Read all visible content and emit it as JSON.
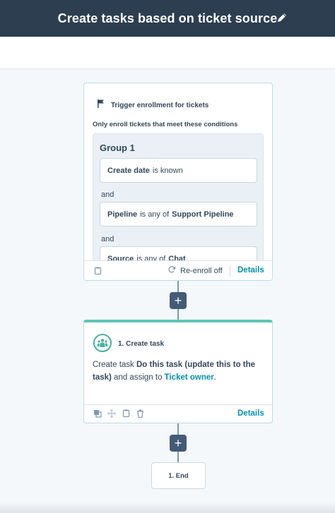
{
  "header": {
    "title": "Create tasks based on ticket source",
    "edit_icon": "pencil-icon"
  },
  "trigger": {
    "icon": "flag-icon",
    "title": "Trigger enrollment for tickets",
    "caption": "Only enroll tickets that meet these conditions",
    "group_title": "Group 1",
    "conditions": [
      {
        "field": "Create date",
        "operator": "is known",
        "value": ""
      },
      {
        "field": "Pipeline",
        "operator": "is any of",
        "value": "Support Pipeline"
      },
      {
        "field": "Source",
        "operator": "is any of",
        "value": "Chat"
      }
    ],
    "and_label": "and",
    "footer": {
      "copy_icon": "copy-icon",
      "reenroll_icon": "refresh-icon",
      "reenroll_label": "Re-enroll off",
      "details_label": "Details"
    }
  },
  "add_action_label": "+",
  "task": {
    "icon": "team-icon",
    "title": "1. Create task",
    "body_prefix": "Create task ",
    "task_name": "Do this task (update this to the task)",
    "body_mid": " and assign to ",
    "assignee": "Ticket owner",
    "body_suffix": ".",
    "footer": {
      "icons": [
        "clone-icon",
        "move-icon",
        "copy-icon",
        "delete-icon"
      ],
      "details_label": "Details"
    },
    "accent_color": "#5ec4b6"
  },
  "end": {
    "label": "1. End"
  },
  "colors": {
    "header_bg": "#2d3e50",
    "link": "#0091ae",
    "card_border": "#b9dde6",
    "plus_bg": "#425b76"
  }
}
